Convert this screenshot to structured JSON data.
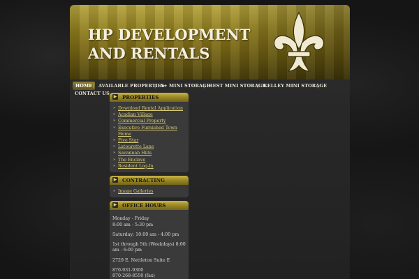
{
  "header": {
    "title_line1": "HP DEVELOPMENT",
    "title_line2": "AND RENTALS",
    "logo_icon": "fleur-de-lis-icon"
  },
  "nav": {
    "items": [
      {
        "label": "HOME",
        "active": true
      },
      {
        "label": "AVAILABLE PROPERTIES"
      },
      {
        "label": "A+ MINI STORAGE"
      },
      {
        "label": "BEST MINI STORAGE"
      },
      {
        "label": "KELLEY MINI STORAGE"
      },
      {
        "label": "CONTACT US"
      }
    ],
    "separator": "|"
  },
  "sidebar": {
    "properties": {
      "title": "PROPERTIES",
      "links": [
        "Download Rental Application",
        "Acadian Village",
        "Commercial Property",
        "Executive Furnished Town Home",
        "Five Star",
        "Latourette Lane",
        "Savannah Hills",
        "The Enclave",
        "Resident Log-In"
      ]
    },
    "contracting": {
      "title": "CONTRACTING",
      "links": [
        "Image Galleries"
      ]
    },
    "office_hours": {
      "title": "OFFICE HOURS",
      "lines": [
        "Monday - Friday",
        "8:00 am - 5:30 pm",
        "Saturday:  10:00 am - 4:00 pm",
        "1st through 5th (Weekdays) 8:00 am - 6:00 pm",
        "2729 E. Nettleton Suite E",
        "870-931-9300",
        "870-268-8550 (fax)"
      ]
    }
  },
  "colors": {
    "banner_gold": "#9a8724",
    "link_gold": "#d9cc74",
    "background": "#151515"
  }
}
